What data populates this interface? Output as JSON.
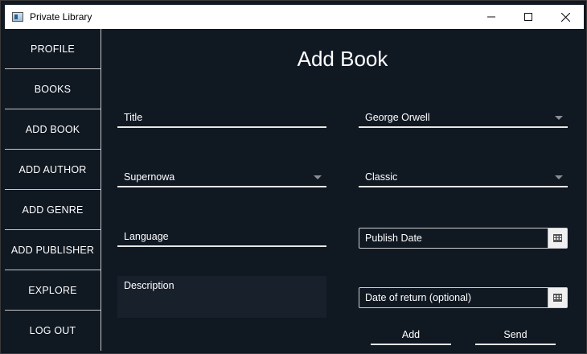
{
  "window": {
    "title": "Private Library",
    "controls": [
      "minimize",
      "maximize",
      "close"
    ]
  },
  "sidebar": {
    "items": [
      {
        "label": "PROFILE"
      },
      {
        "label": "BOOKS"
      },
      {
        "label": "ADD BOOK"
      },
      {
        "label": "ADD AUTHOR"
      },
      {
        "label": "ADD GENRE"
      },
      {
        "label": "ADD PUBLISHER"
      },
      {
        "label": "EXPLORE"
      },
      {
        "label": "LOG OUT"
      }
    ]
  },
  "main": {
    "title": "Add Book",
    "form": {
      "title_placeholder": "Title",
      "author_selected": "George Orwell",
      "publisher_selected": "Supernowa",
      "genre_selected": "Classic",
      "language_placeholder": "Language",
      "publish_date_placeholder": "Publish Date",
      "description_placeholder": "Description",
      "return_date_placeholder": "Date of return (optional)"
    },
    "buttons": {
      "add_label": "Add",
      "send_label": "Send"
    }
  },
  "colors": {
    "background": "#101822",
    "text": "#ffffff",
    "underline": "#e6e6e6",
    "description_bg": "#18202b"
  }
}
